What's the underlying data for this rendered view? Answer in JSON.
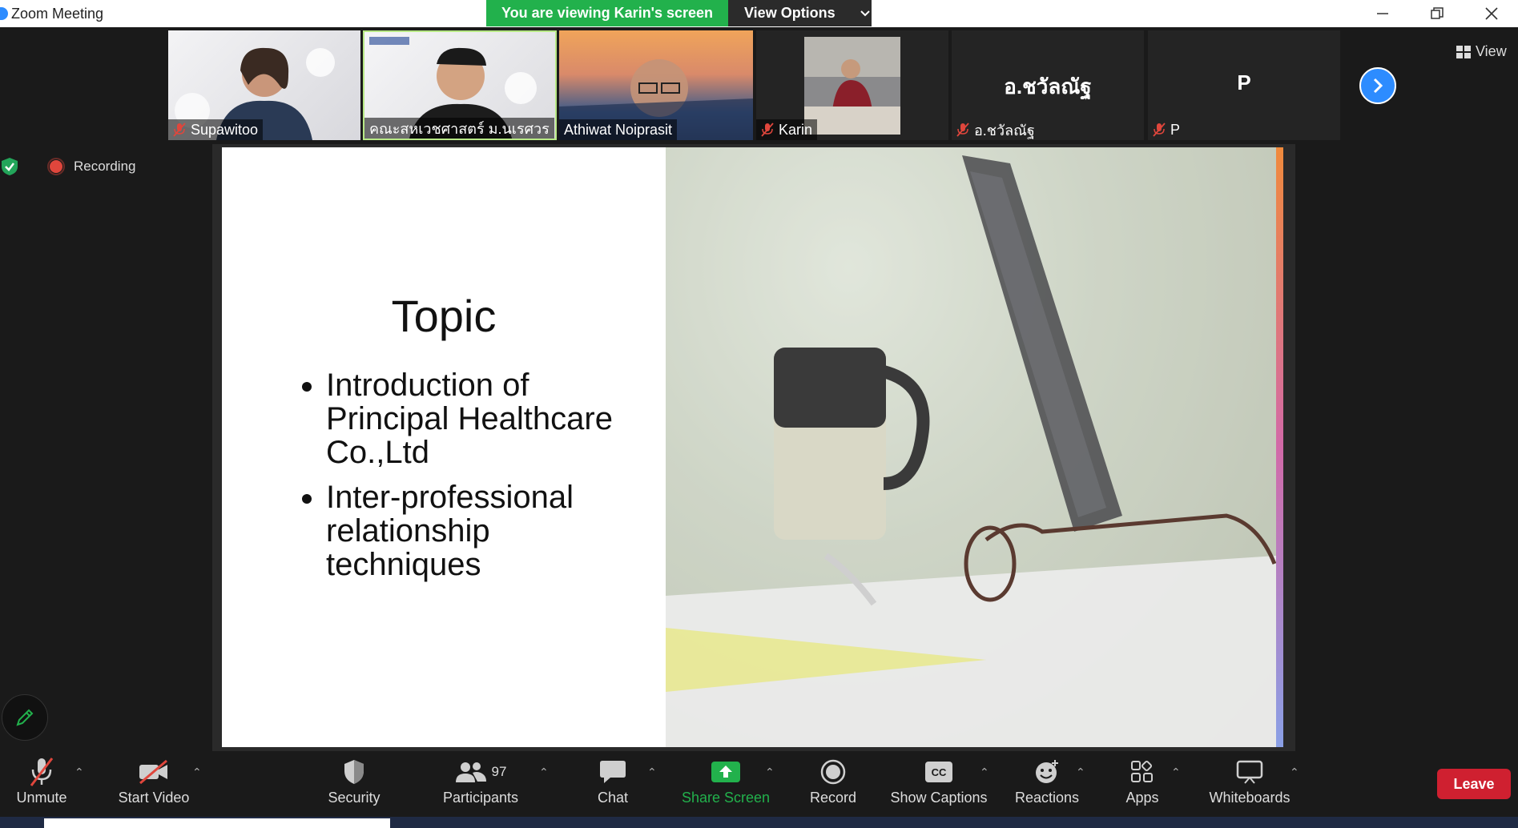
{
  "window": {
    "title": "Zoom Meeting"
  },
  "banner": {
    "viewing_text": "You are viewing Karin's screen",
    "view_options": "View Options"
  },
  "participants_gallery": [
    {
      "name": "Supawitoo",
      "muted": true,
      "video": true
    },
    {
      "name": "คณะสหเวชศาสตร์ ม.นเรศวร",
      "muted": false,
      "video": true,
      "active_speaker": true
    },
    {
      "name": "Athiwat Noiprasit",
      "muted": false,
      "video": true
    },
    {
      "name": "Karin",
      "muted": true,
      "video": true
    },
    {
      "name": "อ.ชวัลณัฐ",
      "display_text": "อ.ชวัลณัฐ",
      "muted": true,
      "video": false
    },
    {
      "name": "P",
      "display_text": "P",
      "muted": true,
      "video": false
    }
  ],
  "recording": {
    "label": "Recording"
  },
  "view_button": {
    "label": "View"
  },
  "slide": {
    "title": "Topic",
    "bullets": [
      "Introduction of Principal Healthcare Co.,Ltd",
      "Inter-professional relationship techniques"
    ]
  },
  "toolbar": {
    "unmute": "Unmute",
    "start_video": "Start Video",
    "security": "Security",
    "participants": "Participants",
    "participants_count": "97",
    "chat": "Chat",
    "share_screen": "Share Screen",
    "record": "Record",
    "show_captions": "Show Captions",
    "captions_icon_text": "CC",
    "reactions": "Reactions",
    "apps": "Apps",
    "whiteboards": "Whiteboards",
    "leave": "Leave"
  },
  "colors": {
    "zoom_blue": "#2d8cff",
    "green": "#22b14c",
    "leave_red": "#cf2030",
    "mute_red": "#e0463c"
  },
  "icons": [
    "shield-icon",
    "participants-icon",
    "chat-icon",
    "share-screen-icon",
    "record-icon",
    "cc-icon",
    "reactions-icon",
    "apps-icon",
    "whiteboard-icon",
    "mic-off-icon",
    "video-off-icon",
    "pencil-icon",
    "chevron-right-icon"
  ]
}
